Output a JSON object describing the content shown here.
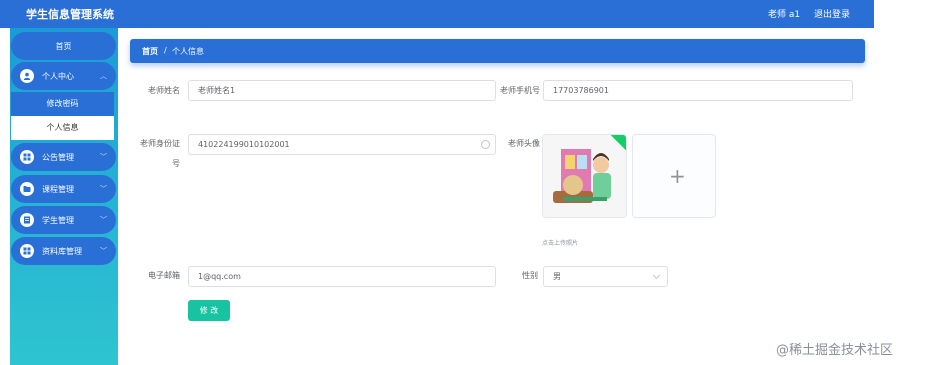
{
  "app": {
    "title": "学生信息管理系统",
    "user": "老师 a1",
    "logout": "退出登录"
  },
  "sidebar": {
    "home": "首页",
    "personal_center": "个人中心",
    "change_password": "修改密码",
    "personal_info": "个人信息",
    "items": [
      {
        "label": "公告管理"
      },
      {
        "label": "课程管理"
      },
      {
        "label": "学生管理"
      },
      {
        "label": "资料库管理"
      }
    ]
  },
  "breadcrumb": {
    "home": "首页",
    "separator": "/",
    "current": "个人信息"
  },
  "form": {
    "name_label": "老师姓名",
    "name_value": "老师姓名1",
    "phone_label": "老师手机号",
    "phone_value": "17703786901",
    "idcard_label": "老师身份证号",
    "idcard_value": "410224199010102001",
    "avatar_label": "老师头像",
    "upload_hint": "点击上传照片",
    "email_label": "电子邮箱",
    "email_value": "1@qq.com",
    "gender_label": "性别",
    "gender_value": "男",
    "save_button": "修 改"
  },
  "watermark": "@稀土掘金技术社区",
  "colors": {
    "primary": "#2a6fd6",
    "sidebar_gradient_top": "#1b9bd6",
    "sidebar_gradient_bottom": "#2ec4d0",
    "save_button": "#17c3a0",
    "avatar_badge": "#13ce66"
  }
}
